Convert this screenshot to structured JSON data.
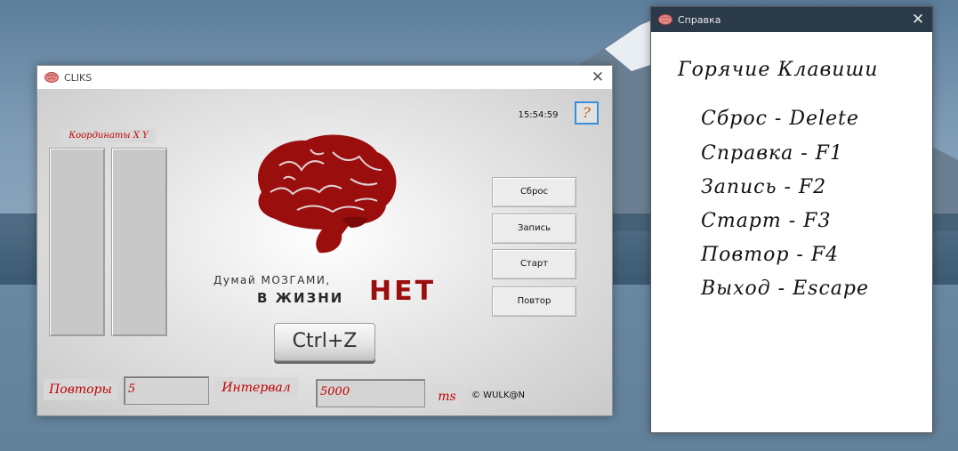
{
  "main_window": {
    "title": "CLIKS",
    "close_glyph": "✕",
    "clock": "15:54:59",
    "help_label": "?",
    "coordinates_label": "Координаты X Y",
    "buttons": {
      "reset": "Сброс",
      "record": "Запись",
      "start": "Старт",
      "repeat": "Повтор"
    },
    "logo": {
      "line1": "Думай МОЗГАМИ,",
      "line2": "В ЖИЗНИ",
      "net": "НЕТ",
      "color": "#9b0e0e"
    },
    "ctrlz_label": "Ctrl+Z",
    "repeats_label": "Повторы",
    "repeats_value": "5",
    "interval_label": "Интервал",
    "interval_value": "5000",
    "ms_label": "ms",
    "copyright": "© WULK@N"
  },
  "help_window": {
    "title": "Справка",
    "close_glyph": "✕",
    "heading": "Горячие Клавиши",
    "hotkeys": [
      "Сброс - Delete",
      "Справка - F1",
      "Запись - F2",
      "Старт - F3",
      "Повтор - F4",
      "Выход - Escape"
    ]
  },
  "colors": {
    "accent_red": "#c00000",
    "help_titlebar": "#2b3a48",
    "focus_blue": "#3a8fd6"
  }
}
